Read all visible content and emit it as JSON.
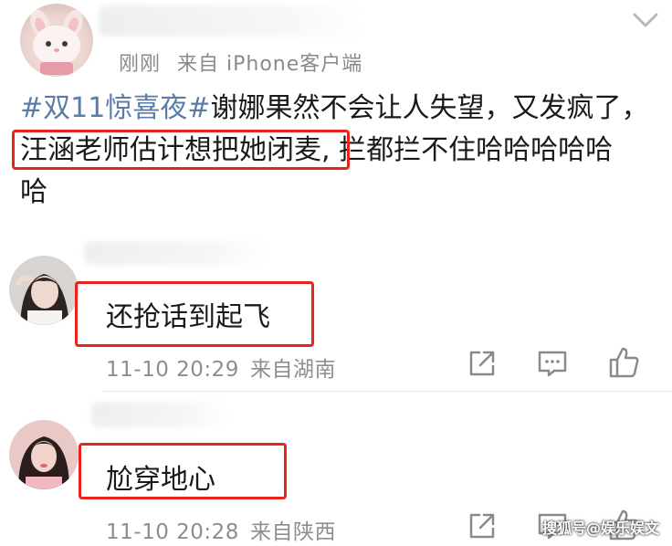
{
  "post": {
    "time": "刚刚",
    "source": "来自 iPhone客户端",
    "hashtag": "#双11惊喜夜#",
    "text_after_hashtag": "谢娜果然不会让人失望，又发疯了，",
    "highlighted": "汪涵老师估计想把她闭麦,",
    "text_tail_line2": "拦都拦不住哈哈哈哈哈",
    "text_line3": "哈"
  },
  "comments": [
    {
      "text": "还抢话到起飞",
      "time": "11-10 20:29",
      "source": "来自湖南"
    },
    {
      "text": "尬穿地心",
      "time": "11-10 20:28",
      "source": "来自陕西"
    }
  ],
  "watermark": "搜狐号@娱乐娱文",
  "colors": {
    "hashtag": "#5c7ca8",
    "highlight_box": "#e8231e",
    "meta": "#8e8e8e"
  },
  "icons": [
    "more-chevron-icon",
    "share-icon",
    "comment-icon",
    "like-icon"
  ]
}
